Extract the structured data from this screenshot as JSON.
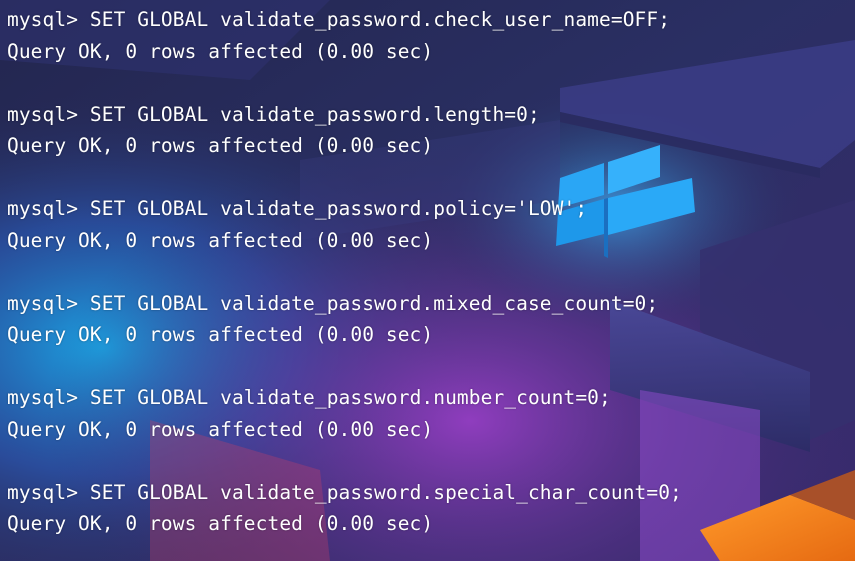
{
  "terminal": {
    "prompt": "mysql>",
    "entries": [
      {
        "command": "SET GLOBAL validate_password.check_user_name=OFF;",
        "result": "Query OK, 0 rows affected (0.00 sec)"
      },
      {
        "command": "SET GLOBAL validate_password.length=0;",
        "result": "Query OK, 0 rows affected (0.00 sec)"
      },
      {
        "command": "SET GLOBAL validate_password.policy='LOW';",
        "result": "Query OK, 0 rows affected (0.00 sec)"
      },
      {
        "command": "SET GLOBAL validate_password.mixed_case_count=0;",
        "result": "Query OK, 0 rows affected (0.00 sec)"
      },
      {
        "command": "SET GLOBAL validate_password.number_count=0;",
        "result": "Query OK, 0 rows affected (0.00 sec)"
      },
      {
        "command": "SET GLOBAL validate_password.special_char_count=0;",
        "result": "Query OK, 0 rows affected (0.00 sec)"
      }
    ]
  },
  "colors": {
    "text": "#ffffff",
    "background_base": "#1a1d4a",
    "accent_blue": "#22a3f0",
    "accent_orange": "#f08a1e",
    "accent_purple": "#7a3fb0"
  },
  "wallpaper_icon": "windows-logo-icon"
}
